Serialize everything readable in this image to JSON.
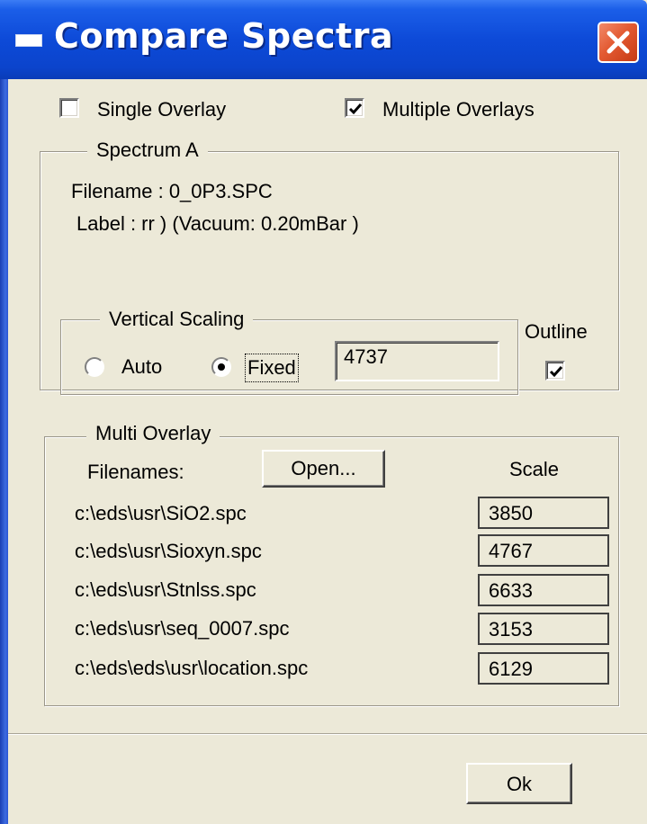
{
  "window": {
    "title": "Compare Spectra"
  },
  "options": {
    "single_overlay": {
      "label": "Single Overlay",
      "checked": false
    },
    "multiple_overlays": {
      "label": "Multiple Overlays",
      "checked": true
    }
  },
  "spectrum_a": {
    "legend": "Spectrum A",
    "filename_line": "Filename :  0_0P3.SPC",
    "label_line": "Label : rr )  (Vacuum: 0.20mBar )",
    "vertical_scaling": {
      "legend": "Vertical Scaling",
      "auto_label": "Auto",
      "fixed_label": "Fixed",
      "selected": "Fixed",
      "fixed_value": "4737"
    },
    "outline": {
      "label": "Outline",
      "checked": true
    }
  },
  "multi_overlay": {
    "legend": "Multi Overlay",
    "filenames_label": "Filenames:",
    "open_button": "Open...",
    "scale_header": "Scale",
    "files": [
      {
        "path": "c:\\eds\\usr\\SiO2.spc",
        "scale": "3850"
      },
      {
        "path": "c:\\eds\\usr\\Sioxyn.spc",
        "scale": "4767"
      },
      {
        "path": "c:\\eds\\usr\\Stnlss.spc",
        "scale": "6633"
      },
      {
        "path": "c:\\eds\\usr\\seq_0007.spc",
        "scale": "3153"
      },
      {
        "path": "c:\\eds\\eds\\usr\\location.spc",
        "scale": "6129"
      }
    ]
  },
  "footer": {
    "ok_button": "Ok"
  }
}
